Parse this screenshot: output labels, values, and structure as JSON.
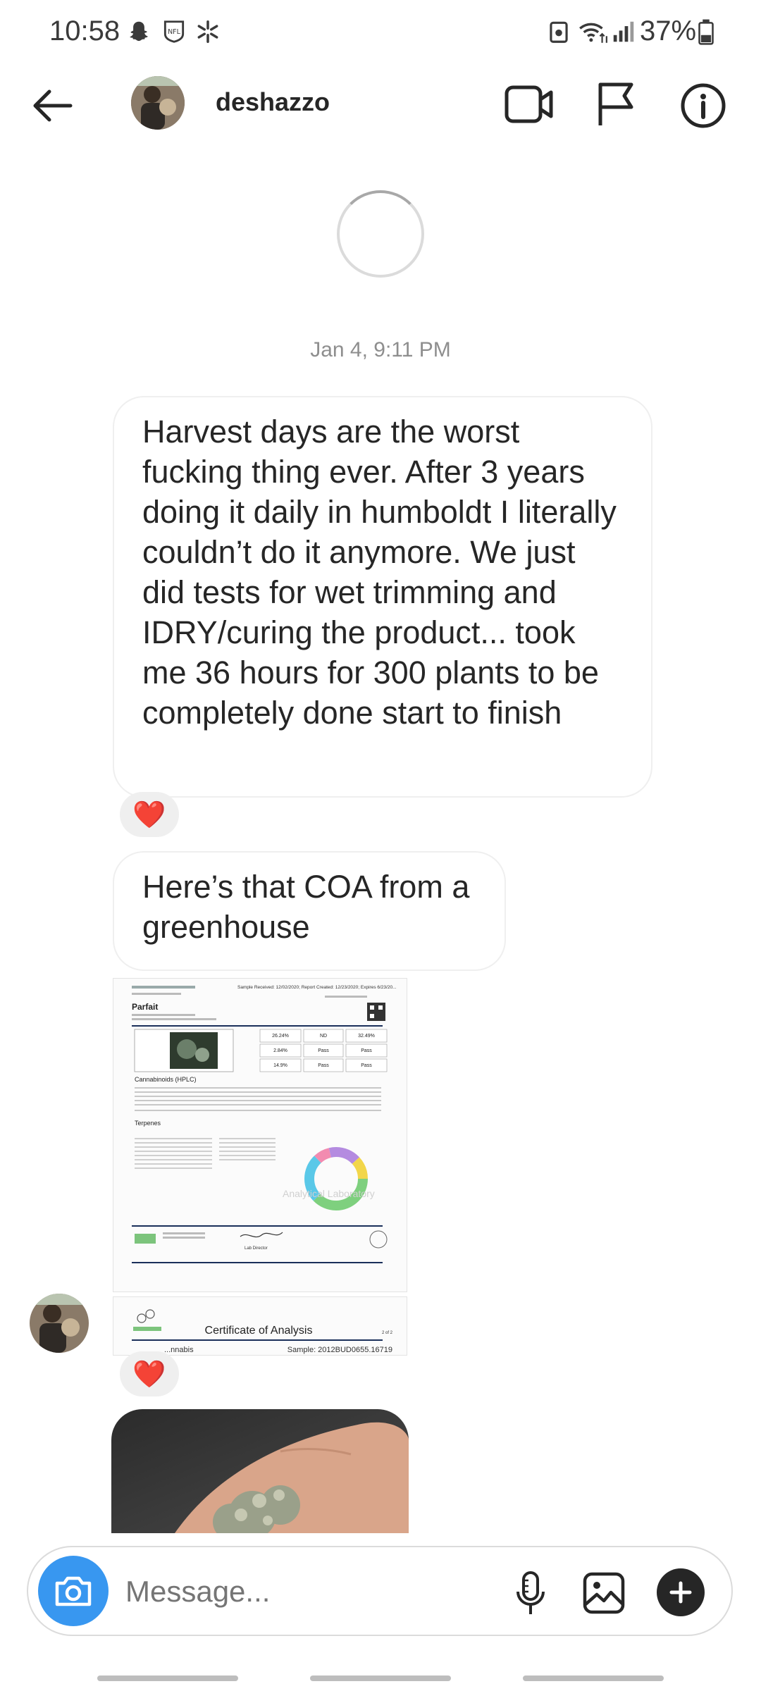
{
  "status_bar": {
    "time": "10:58",
    "battery": "37%",
    "icons": [
      "snapchat-icon",
      "nfl-icon",
      "star-icon",
      "recycle-icon",
      "wifi-icon",
      "signal-icon",
      "battery-icon"
    ]
  },
  "header": {
    "username": "deshazzo",
    "back_icon": "back-arrow-icon",
    "video_icon": "video-call-icon",
    "flag_icon": "flag-icon",
    "info_icon": "info-icon"
  },
  "thread": {
    "date": "Jan 4, 9:11 PM",
    "messages": [
      {
        "text": "Harvest days are the worst fucking thing ever. After 3 years doing it daily in humboldt I literally couldn’t do it anymore. We just did tests for wet trimming and IDRY/curing the product... took me 36 hours for 300 plants to be completely done start to finish",
        "reaction": "❤️"
      },
      {
        "text": "Here’s that COA from a greenhouse"
      }
    ],
    "coa_page1": {
      "header_right": "Sample Received: 12/02/2020; Report Created: 12/23/2020; Expires 6/23/20...",
      "strain": "Parfait",
      "section_cannabinoids": "Cannabinoids (HPLC)",
      "section_terpenes": "Terpenes",
      "watermark": "Analytical Laboratory",
      "stats": [
        "26.24%",
        "ND",
        "32.49%",
        "2.84%",
        "Pass",
        "Pass",
        "14.9%",
        "Pass",
        "Pass"
      ],
      "signer": "Lab Director"
    },
    "coa_page2": {
      "title": "Certificate of Analysis",
      "sub_left": "...nnabis",
      "sub_right": "Sample: 2012BUD0655.16719",
      "corner": "2 of 2"
    },
    "reaction2": "❤️"
  },
  "composer": {
    "placeholder": "Message...",
    "camera_icon": "camera-icon",
    "mic_icon": "microphone-icon",
    "gallery_icon": "gallery-icon",
    "plus_icon": "plus-icon"
  },
  "colors": {
    "accent_blue": "#3897f0",
    "text": "#262626",
    "muted": "#8e8e8e",
    "border": "#efefef",
    "heart": "#ed1c24"
  }
}
